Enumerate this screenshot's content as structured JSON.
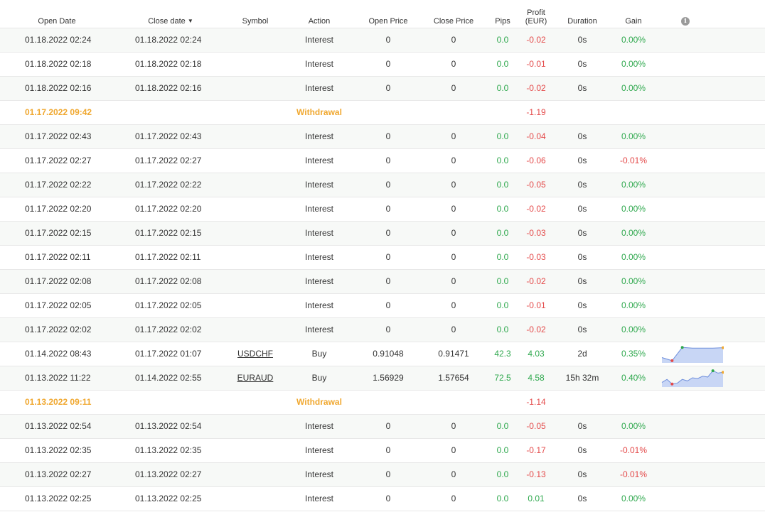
{
  "header": {
    "open_date": "Open Date",
    "close_date": "Close date",
    "sort_caret": "▼",
    "symbol": "Symbol",
    "action": "Action",
    "open_price": "Open Price",
    "close_price": "Close Price",
    "pips": "Pips",
    "profit_line1": "Profit",
    "profit_line2": "(EUR)",
    "duration": "Duration",
    "gain": "Gain",
    "info_icon": "info-icon",
    "info_glyph": "i"
  },
  "colors": {
    "positive": "#2ea84d",
    "negative": "#e44a4a",
    "withdrawal": "#f0a830",
    "row_alt": "#f7f9f7"
  },
  "rows": [
    {
      "type": "trade",
      "open": "01.18.2022 02:24",
      "close": "01.18.2022 02:24",
      "symbol": "",
      "action": "Interest",
      "open_price": "0",
      "close_price": "0",
      "pips": "0.0",
      "profit": "-0.02",
      "duration": "0s",
      "gain": "0.00%"
    },
    {
      "type": "trade",
      "open": "01.18.2022 02:18",
      "close": "01.18.2022 02:18",
      "symbol": "",
      "action": "Interest",
      "open_price": "0",
      "close_price": "0",
      "pips": "0.0",
      "profit": "-0.01",
      "duration": "0s",
      "gain": "0.00%"
    },
    {
      "type": "trade",
      "open": "01.18.2022 02:16",
      "close": "01.18.2022 02:16",
      "symbol": "",
      "action": "Interest",
      "open_price": "0",
      "close_price": "0",
      "pips": "0.0",
      "profit": "-0.02",
      "duration": "0s",
      "gain": "0.00%"
    },
    {
      "type": "withdrawal",
      "open": "01.17.2022 09:42",
      "action": "Withdrawal",
      "profit": "-1.19"
    },
    {
      "type": "trade",
      "open": "01.17.2022 02:43",
      "close": "01.17.2022 02:43",
      "symbol": "",
      "action": "Interest",
      "open_price": "0",
      "close_price": "0",
      "pips": "0.0",
      "profit": "-0.04",
      "duration": "0s",
      "gain": "0.00%"
    },
    {
      "type": "trade",
      "open": "01.17.2022 02:27",
      "close": "01.17.2022 02:27",
      "symbol": "",
      "action": "Interest",
      "open_price": "0",
      "close_price": "0",
      "pips": "0.0",
      "profit": "-0.06",
      "duration": "0s",
      "gain": "-0.01%"
    },
    {
      "type": "trade",
      "open": "01.17.2022 02:22",
      "close": "01.17.2022 02:22",
      "symbol": "",
      "action": "Interest",
      "open_price": "0",
      "close_price": "0",
      "pips": "0.0",
      "profit": "-0.05",
      "duration": "0s",
      "gain": "0.00%"
    },
    {
      "type": "trade",
      "open": "01.17.2022 02:20",
      "close": "01.17.2022 02:20",
      "symbol": "",
      "action": "Interest",
      "open_price": "0",
      "close_price": "0",
      "pips": "0.0",
      "profit": "-0.02",
      "duration": "0s",
      "gain": "0.00%"
    },
    {
      "type": "trade",
      "open": "01.17.2022 02:15",
      "close": "01.17.2022 02:15",
      "symbol": "",
      "action": "Interest",
      "open_price": "0",
      "close_price": "0",
      "pips": "0.0",
      "profit": "-0.03",
      "duration": "0s",
      "gain": "0.00%"
    },
    {
      "type": "trade",
      "open": "01.17.2022 02:11",
      "close": "01.17.2022 02:11",
      "symbol": "",
      "action": "Interest",
      "open_price": "0",
      "close_price": "0",
      "pips": "0.0",
      "profit": "-0.03",
      "duration": "0s",
      "gain": "0.00%"
    },
    {
      "type": "trade",
      "open": "01.17.2022 02:08",
      "close": "01.17.2022 02:08",
      "symbol": "",
      "action": "Interest",
      "open_price": "0",
      "close_price": "0",
      "pips": "0.0",
      "profit": "-0.02",
      "duration": "0s",
      "gain": "0.00%"
    },
    {
      "type": "trade",
      "open": "01.17.2022 02:05",
      "close": "01.17.2022 02:05",
      "symbol": "",
      "action": "Interest",
      "open_price": "0",
      "close_price": "0",
      "pips": "0.0",
      "profit": "-0.01",
      "duration": "0s",
      "gain": "0.00%"
    },
    {
      "type": "trade",
      "open": "01.17.2022 02:02",
      "close": "01.17.2022 02:02",
      "symbol": "",
      "action": "Interest",
      "open_price": "0",
      "close_price": "0",
      "pips": "0.0",
      "profit": "-0.02",
      "duration": "0s",
      "gain": "0.00%"
    },
    {
      "type": "trade",
      "open": "01.14.2022 08:43",
      "close": "01.17.2022 01:07",
      "symbol": "USDCHF",
      "action": "Buy",
      "open_price": "0.91048",
      "close_price": "0.91471",
      "pips": "42.3",
      "profit": "4.03",
      "duration": "2d",
      "gain": "0.35%",
      "spark": [
        0.25,
        0.05,
        0.9,
        0.85,
        0.85,
        0.85,
        0.88
      ]
    },
    {
      "type": "trade",
      "open": "01.13.2022 11:22",
      "close": "01.14.2022 02:55",
      "symbol": "EURAUD",
      "action": "Buy",
      "open_price": "1.56929",
      "close_price": "1.57654",
      "pips": "72.5",
      "profit": "4.58",
      "duration": "15h 32m",
      "gain": "0.40%",
      "spark": [
        0.2,
        0.4,
        0.1,
        0.15,
        0.4,
        0.3,
        0.5,
        0.45,
        0.6,
        0.55,
        0.95,
        0.8,
        0.85
      ]
    },
    {
      "type": "withdrawal",
      "open": "01.13.2022 09:11",
      "action": "Withdrawal",
      "profit": "-1.14"
    },
    {
      "type": "trade",
      "open": "01.13.2022 02:54",
      "close": "01.13.2022 02:54",
      "symbol": "",
      "action": "Interest",
      "open_price": "0",
      "close_price": "0",
      "pips": "0.0",
      "profit": "-0.05",
      "duration": "0s",
      "gain": "0.00%"
    },
    {
      "type": "trade",
      "open": "01.13.2022 02:35",
      "close": "01.13.2022 02:35",
      "symbol": "",
      "action": "Interest",
      "open_price": "0",
      "close_price": "0",
      "pips": "0.0",
      "profit": "-0.17",
      "duration": "0s",
      "gain": "-0.01%"
    },
    {
      "type": "trade",
      "open": "01.13.2022 02:27",
      "close": "01.13.2022 02:27",
      "symbol": "",
      "action": "Interest",
      "open_price": "0",
      "close_price": "0",
      "pips": "0.0",
      "profit": "-0.13",
      "duration": "0s",
      "gain": "-0.01%"
    },
    {
      "type": "trade",
      "open": "01.13.2022 02:25",
      "close": "01.13.2022 02:25",
      "symbol": "",
      "action": "Interest",
      "open_price": "0",
      "close_price": "0",
      "pips": "0.0",
      "profit": "0.01",
      "duration": "0s",
      "gain": "0.00%"
    }
  ]
}
